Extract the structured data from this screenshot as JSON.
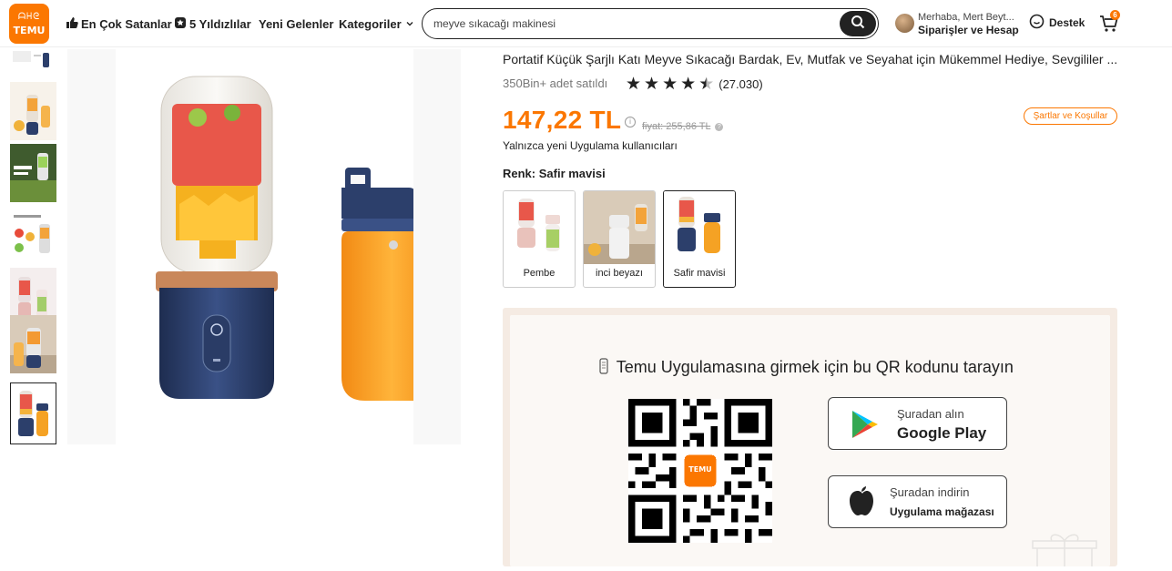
{
  "header": {
    "logo_text": "TEMU",
    "logo_glyphs": "ᗩᕼᘓ",
    "nav": [
      {
        "label": "En Çok Satanlar",
        "icon": "thumbs-up-icon"
      },
      {
        "label": "5 Yıldızlılar",
        "icon": "star-badge-icon"
      },
      {
        "label": "Yeni Gelenler"
      },
      {
        "label": "Kategoriler",
        "icon": "chevron-down-icon"
      }
    ],
    "search_value": "meyve sıkacağı makinesi",
    "greeting": "Merhaba, Mert Beyt...",
    "orders_label": "Siparişler ve Hesap",
    "support_label": "Destek",
    "cart_count": "6"
  },
  "product": {
    "title": "Portatif Küçük Şarjlı Katı Meyve Sıkacağı Bardak, Ev, Mutfak ve Seyahat için Mükemmel Hediye, Sevgililer ...",
    "sold": "350Bin+ adet satıldı",
    "rating": 4.5,
    "rating_count": "(27.030)",
    "price": "147,22 TL",
    "price_info": "i",
    "old_price_label": "fiyat: 255,86 TL",
    "old_price_info": "?",
    "terms_label": "Şartlar ve Koşullar",
    "new_user_note": "Yalnızca yeni Uygulama kullanıcıları",
    "color_label": "Renk: Safir mavisi",
    "variants": [
      {
        "label": "Pembe"
      },
      {
        "label": "inci beyazı"
      },
      {
        "label": "Safir mavisi",
        "selected": true
      }
    ],
    "thumbnail_count": 7,
    "selected_thumbnail": 7
  },
  "qr": {
    "title": "Temu Uygulamasına girmek için bu QR kodunu tarayın",
    "logo_text": "TEMU",
    "google": {
      "small": "Şuradan alın",
      "big": "Google Play"
    },
    "apple": {
      "small": "Şuradan indirin",
      "big": "Uygulama mağazası"
    }
  },
  "colors": {
    "brand_orange": "#fb7701",
    "text_dark": "#222222",
    "panel_beige": "#f5ebe3",
    "sapphire_blue": "#2c3f6b"
  }
}
